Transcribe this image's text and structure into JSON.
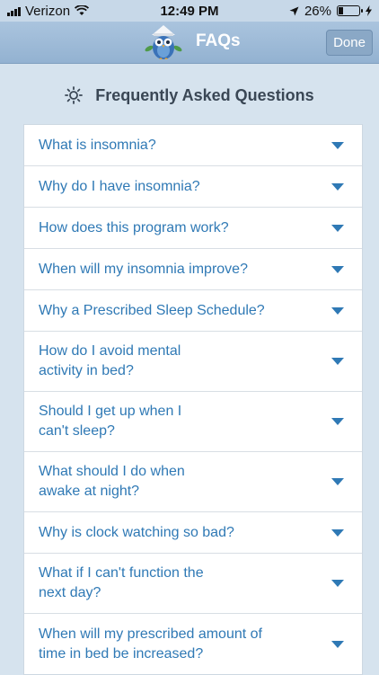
{
  "status_bar": {
    "carrier": "Verizon",
    "time": "12:49 PM",
    "battery": "26%",
    "battery_level": 0.26
  },
  "nav": {
    "title": "FAQs",
    "done_label": "Done"
  },
  "header": {
    "title": "Frequently Asked Questions"
  },
  "faqs": [
    {
      "question": "What is insomnia?"
    },
    {
      "question": "Why do I have insomnia?"
    },
    {
      "question": "How does this program work?"
    },
    {
      "question": "When will my insomnia improve?"
    },
    {
      "question": "Why a Prescribed Sleep Schedule?"
    },
    {
      "question": "How do I avoid mental activity in bed?"
    },
    {
      "question": "Should I get up when I can't sleep?"
    },
    {
      "question": "What should I do when awake at night?"
    },
    {
      "question": "Why is clock watching so bad?"
    },
    {
      "question": "What if I can't function the next day?"
    },
    {
      "question": "When will my prescribed amount of time in bed be increased?"
    }
  ]
}
